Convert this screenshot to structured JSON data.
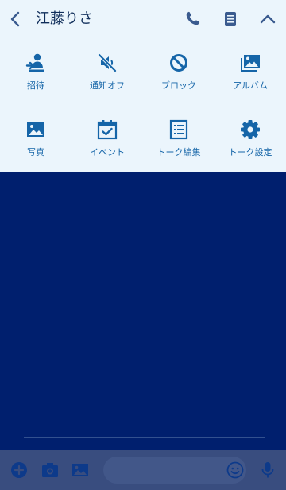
{
  "header": {
    "title": "江藤りさ",
    "back_icon": "chevron-left-icon",
    "call_icon": "phone-icon",
    "notes_icon": "note-icon",
    "collapse_icon": "chevron-up-icon"
  },
  "menu": {
    "items": [
      {
        "label": "招待",
        "icon": "invite-user-icon"
      },
      {
        "label": "通知オフ",
        "icon": "speaker-mute-icon"
      },
      {
        "label": "ブロック",
        "icon": "block-icon"
      },
      {
        "label": "アルバム",
        "icon": "album-icon"
      },
      {
        "label": "写真",
        "icon": "photo-icon"
      },
      {
        "label": "イベント",
        "icon": "calendar-check-icon"
      },
      {
        "label": "トーク編集",
        "icon": "edit-list-icon"
      },
      {
        "label": "トーク設定",
        "icon": "gear-icon"
      }
    ]
  },
  "input_bar": {
    "message_placeholder": "",
    "icons": [
      "plus-circle-icon",
      "camera-icon",
      "image-icon",
      "smiley-icon",
      "microphone-icon"
    ]
  },
  "colors": {
    "header_bg": "#ebf5fc",
    "accent": "#1565a8",
    "chat_bg": "#001f6e",
    "input_bar_bg": "#394d7f",
    "header_icon": "#3a5b8f",
    "bar_icon": "#0d3a8a"
  }
}
